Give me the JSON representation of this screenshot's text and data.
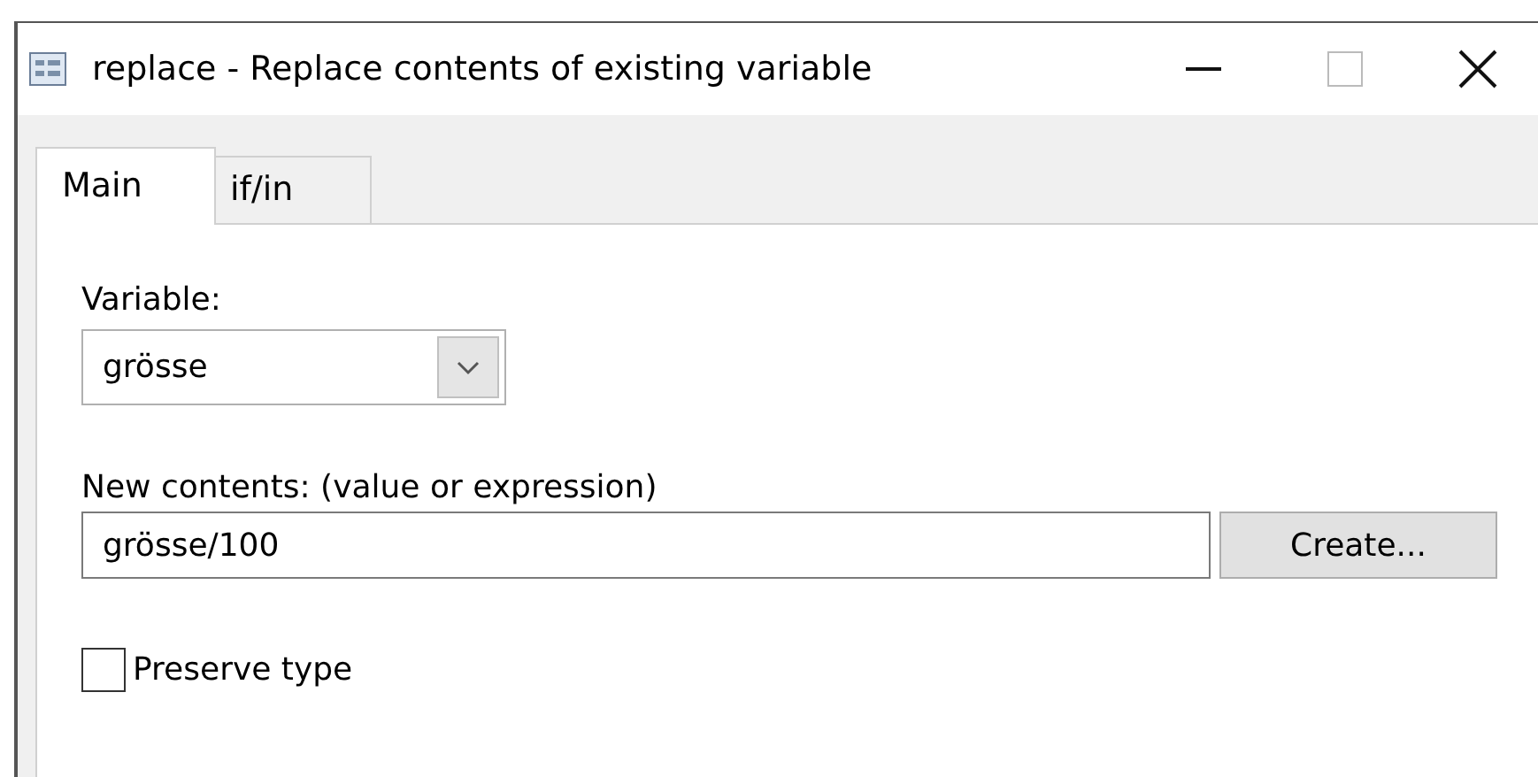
{
  "window": {
    "title": "replace - Replace contents of existing variable"
  },
  "tabs": [
    {
      "label": "Main",
      "selected": true
    },
    {
      "label": "if/in",
      "selected": false
    }
  ],
  "variable": {
    "label": "Variable:",
    "value": "grösse"
  },
  "new_contents": {
    "label": "New contents: (value or expression)",
    "value": "grösse/100"
  },
  "create_button": "Create...",
  "preserve_type": {
    "label": "Preserve type",
    "checked": false
  }
}
